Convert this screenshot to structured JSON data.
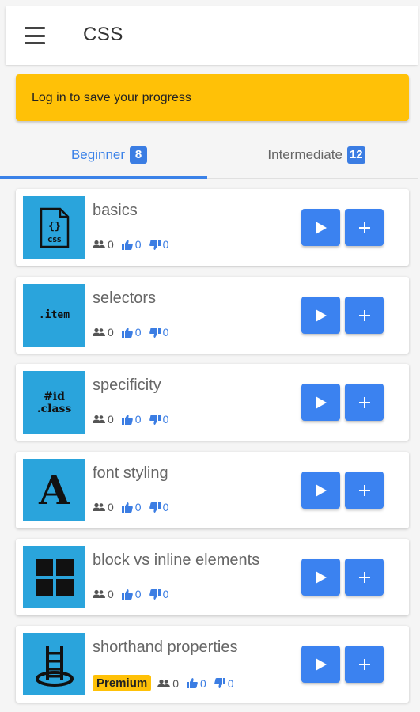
{
  "header": {
    "title": "CSS"
  },
  "banner": {
    "text": "Log in to save your progress"
  },
  "tabs": [
    {
      "label": "Beginner",
      "count": "8"
    },
    {
      "label": "Intermediate",
      "count": "12"
    }
  ],
  "lessons": [
    {
      "title": "basics",
      "thumb_icon": "css-file-icon",
      "thumb_text": "CSS",
      "users": "0",
      "likes": "0",
      "dislikes": "0"
    },
    {
      "title": "selectors",
      "thumb_icon": "selector-item-icon",
      "thumb_text": ".item",
      "users": "0",
      "likes": "0",
      "dislikes": "0"
    },
    {
      "title": "specificity",
      "thumb_icon": "specificity-icon",
      "thumb_text": "#id .class",
      "users": "0",
      "likes": "0",
      "dislikes": "0"
    },
    {
      "title": "font styling",
      "thumb_icon": "font-letter-icon",
      "thumb_text": "A",
      "users": "0",
      "likes": "0",
      "dislikes": "0"
    },
    {
      "title": "block vs inline elements",
      "thumb_icon": "grid-blocks-icon",
      "users": "0",
      "likes": "0",
      "dislikes": "0"
    },
    {
      "title": "shorthand properties",
      "thumb_icon": "ladder-icon",
      "premium_label": "Premium",
      "users": "0",
      "likes": "0",
      "dislikes": "0"
    }
  ],
  "colors": {
    "accent": "#3b82e8",
    "banner": "#ffc107",
    "thumb_bg": "#2aa4dc",
    "button": "#3b82f0"
  }
}
